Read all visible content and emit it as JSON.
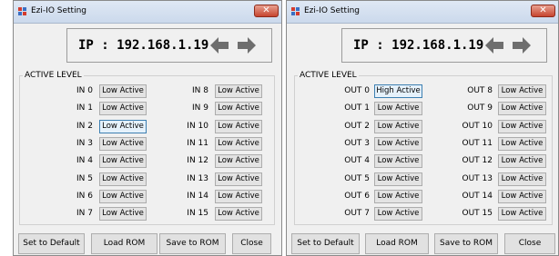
{
  "windows": [
    {
      "title": "Ezi-IO Setting",
      "close_glyph": "✕",
      "ip_display": "IP : 192.168.1.19",
      "group_label": "ACTIVE LEVEL",
      "left_col": [
        {
          "label": "IN 0",
          "value": "Low Active"
        },
        {
          "label": "IN 1",
          "value": "Low Active"
        },
        {
          "label": "IN 2",
          "value": "Low Active"
        },
        {
          "label": "IN 3",
          "value": "Low Active"
        },
        {
          "label": "IN 4",
          "value": "Low Active"
        },
        {
          "label": "IN 5",
          "value": "Low Active"
        },
        {
          "label": "IN 6",
          "value": "Low Active"
        },
        {
          "label": "IN 7",
          "value": "Low Active"
        }
      ],
      "right_col": [
        {
          "label": "IN 8",
          "value": "Low Active"
        },
        {
          "label": "IN 9",
          "value": "Low Active"
        },
        {
          "label": "IN 10",
          "value": "Low Active"
        },
        {
          "label": "IN 11",
          "value": "Low Active"
        },
        {
          "label": "IN 12",
          "value": "Low Active"
        },
        {
          "label": "IN 13",
          "value": "Low Active"
        },
        {
          "label": "IN 14",
          "value": "Low Active"
        },
        {
          "label": "IN 15",
          "value": "Low Active"
        }
      ],
      "buttons": {
        "set_default": "Set to Default",
        "load_rom": "Load ROM",
        "save_rom": "Save to ROM",
        "close": "Close"
      }
    },
    {
      "title": "Ezi-IO Setting",
      "close_glyph": "✕",
      "ip_display": "IP : 192.168.1.19",
      "group_label": "ACTIVE LEVEL",
      "left_col": [
        {
          "label": "OUT 0",
          "value": "High Active"
        },
        {
          "label": "OUT 1",
          "value": "Low Active"
        },
        {
          "label": "OUT 2",
          "value": "Low Active"
        },
        {
          "label": "OUT 3",
          "value": "Low Active"
        },
        {
          "label": "OUT 4",
          "value": "Low Active"
        },
        {
          "label": "OUT 5",
          "value": "Low Active"
        },
        {
          "label": "OUT 6",
          "value": "Low Active"
        },
        {
          "label": "OUT 7",
          "value": "Low Active"
        }
      ],
      "right_col": [
        {
          "label": "OUT 8",
          "value": "Low Active"
        },
        {
          "label": "OUT 9",
          "value": "Low Active"
        },
        {
          "label": "OUT 10",
          "value": "Low Active"
        },
        {
          "label": "OUT 11",
          "value": "Low Active"
        },
        {
          "label": "OUT 12",
          "value": "Low Active"
        },
        {
          "label": "OUT 13",
          "value": "Low Active"
        },
        {
          "label": "OUT 14",
          "value": "Low Active"
        },
        {
          "label": "OUT 15",
          "value": "Low Active"
        }
      ],
      "buttons": {
        "set_default": "Set to Default",
        "load_rom": "Load ROM",
        "save_rom": "Save to ROM",
        "close": "Close"
      }
    }
  ],
  "icons": {
    "app": "app-grid-icon",
    "prev": "arrow-left-icon",
    "next": "arrow-right-icon",
    "close": "close-icon"
  },
  "colors": {
    "close_button": "#c6452f",
    "arrow": "#6e6e6e",
    "selected_border": "#3c7fb1"
  }
}
